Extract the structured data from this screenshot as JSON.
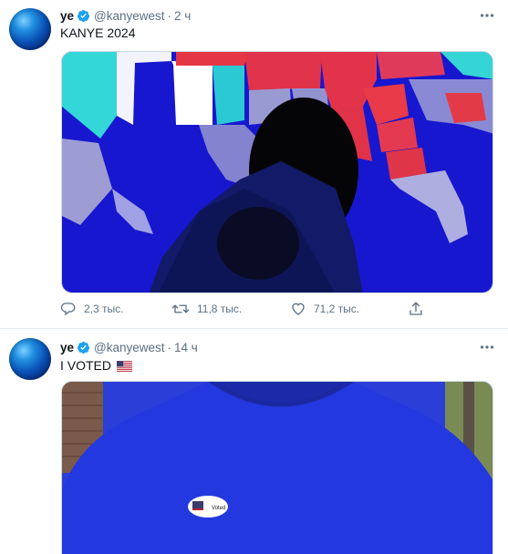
{
  "tweets": [
    {
      "name": "ye",
      "handle": "@kanyewest",
      "separator": "·",
      "time": "2 ч",
      "text": "KANYE 2024",
      "media_icon": "election-map-photo",
      "actions": {
        "reply_count": "2,3 тыс.",
        "retweet_count": "11,8 тыс.",
        "like_count": "71,2 тыс."
      }
    },
    {
      "name": "ye",
      "handle": "@kanyewest",
      "separator": "·",
      "time": "14 ч",
      "text": "I VOTED",
      "emoji": "us-flag-icon",
      "media_icon": "voted-hoodie-photo"
    }
  ],
  "colors": {
    "accent": "#1da1f2",
    "secondary_text": "#5b7083",
    "border": "#e6ecf0"
  }
}
